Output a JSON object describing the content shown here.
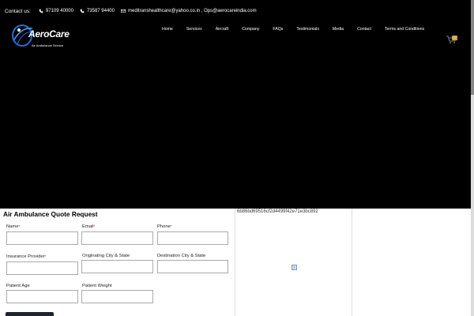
{
  "topbar": {
    "contact_label": "Contact us:",
    "phone1": "97109 40000",
    "phone2": "73587 94400",
    "email": "meditranshealthcare@yahoo.co.in , Ops@aerocareindia.com"
  },
  "logo": {
    "name_a": "Aero",
    "name_b": "Care",
    "subtitle": "Air Ambulance Service"
  },
  "nav": {
    "items": [
      "Home",
      "Services",
      "Aircraft",
      "Company",
      "FAQs",
      "Testimonials",
      "Media",
      "Contact",
      "Terms and Conditions"
    ]
  },
  "cart": {
    "count": "0"
  },
  "form": {
    "title": "Air Ambulance Quote Request",
    "fields": {
      "name": {
        "label": "Name",
        "required": "*"
      },
      "email": {
        "label": "Email",
        "required": "*"
      },
      "phone": {
        "label": "Phone",
        "required": "*"
      },
      "insurance": {
        "label": "Insurance Provider",
        "required": "*"
      },
      "origin": {
        "label": "Originating City & State"
      },
      "destination": {
        "label": "Destination City & State"
      },
      "age": {
        "label": "Patient Age"
      },
      "weight": {
        "label": "Patient Weight"
      }
    }
  },
  "side": {
    "hash": "6b86bd69516cf2d4499f42e71e3bc892",
    "broken_image_glyph": "?"
  },
  "colors": {
    "hero_bg": "#000000",
    "accent": "#c9a642",
    "logo_blue": "#1f6fd6",
    "button": "#1d2530"
  }
}
